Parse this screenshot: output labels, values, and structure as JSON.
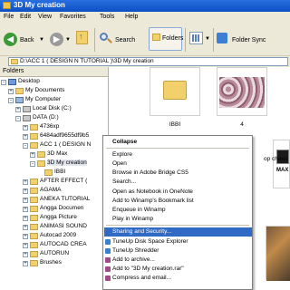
{
  "window": {
    "title": "3D My creation"
  },
  "menubar": {
    "items": [
      "File",
      "Edit",
      "View",
      "Favorites",
      "Tools",
      "Help"
    ]
  },
  "toolbar": {
    "back": "Back",
    "search": "Search",
    "folders": "Folders",
    "folder_sync": "Folder Sync"
  },
  "address": {
    "path": "D:\\ACC 1 ( DESIGN N TUTORIAL )\\3D My creation"
  },
  "folders_pane": {
    "header": "Folders",
    "tree": [
      {
        "label": "Desktop"
      },
      {
        "label": "My Documents"
      },
      {
        "label": "My Computer"
      },
      {
        "label": "Local Disk (C:)"
      },
      {
        "label": "DATA (D:)"
      },
      {
        "label": "4736xp"
      },
      {
        "label": "6484adf9655df9b5"
      },
      {
        "label": "ACC 1 ( DESIGN N"
      },
      {
        "label": "3D Max"
      },
      {
        "label": "3D My creation"
      },
      {
        "label": "IBBI"
      },
      {
        "label": "AFTER EFFECT ("
      },
      {
        "label": "AGAMA"
      },
      {
        "label": "ANEKA TUTORIAL"
      },
      {
        "label": "Angga Documen"
      },
      {
        "label": "Angga Picture"
      },
      {
        "label": "ANIMASI SOUND"
      },
      {
        "label": "Autocad 2009"
      },
      {
        "label": "AUTOCAD CREA"
      },
      {
        "label": "AUTORUN"
      },
      {
        "label": "Brushes"
      }
    ]
  },
  "content": {
    "items": [
      {
        "caption": "IBBI"
      },
      {
        "caption": "4"
      }
    ],
    "partial_caption": "op chees",
    "max_badge": "MAX"
  },
  "context_menu": {
    "items": [
      {
        "label": "Collapse"
      },
      {
        "label": "Explore"
      },
      {
        "label": "Open"
      },
      {
        "label": "Browse in Adobe Bridge CS5"
      },
      {
        "label": "Search..."
      },
      {
        "label": "Open as Notebook in OneNote"
      },
      {
        "label": "Add to Winamp's Bookmark list"
      },
      {
        "label": "Enqueue in Winamp"
      },
      {
        "label": "Play in Winamp"
      },
      {
        "label": "Sharing and Security..."
      },
      {
        "label": "TuneUp Disk Space Explorer"
      },
      {
        "label": "TuneUp Shredder"
      },
      {
        "label": "Add to archive..."
      },
      {
        "label": "Add to \"3D My creation.rar\""
      },
      {
        "label": "Compress and email..."
      }
    ]
  },
  "colors": {
    "titlebar": "#0b4fc4",
    "menu_highlight": "#316ac5",
    "chrome": "#ece9d8"
  }
}
